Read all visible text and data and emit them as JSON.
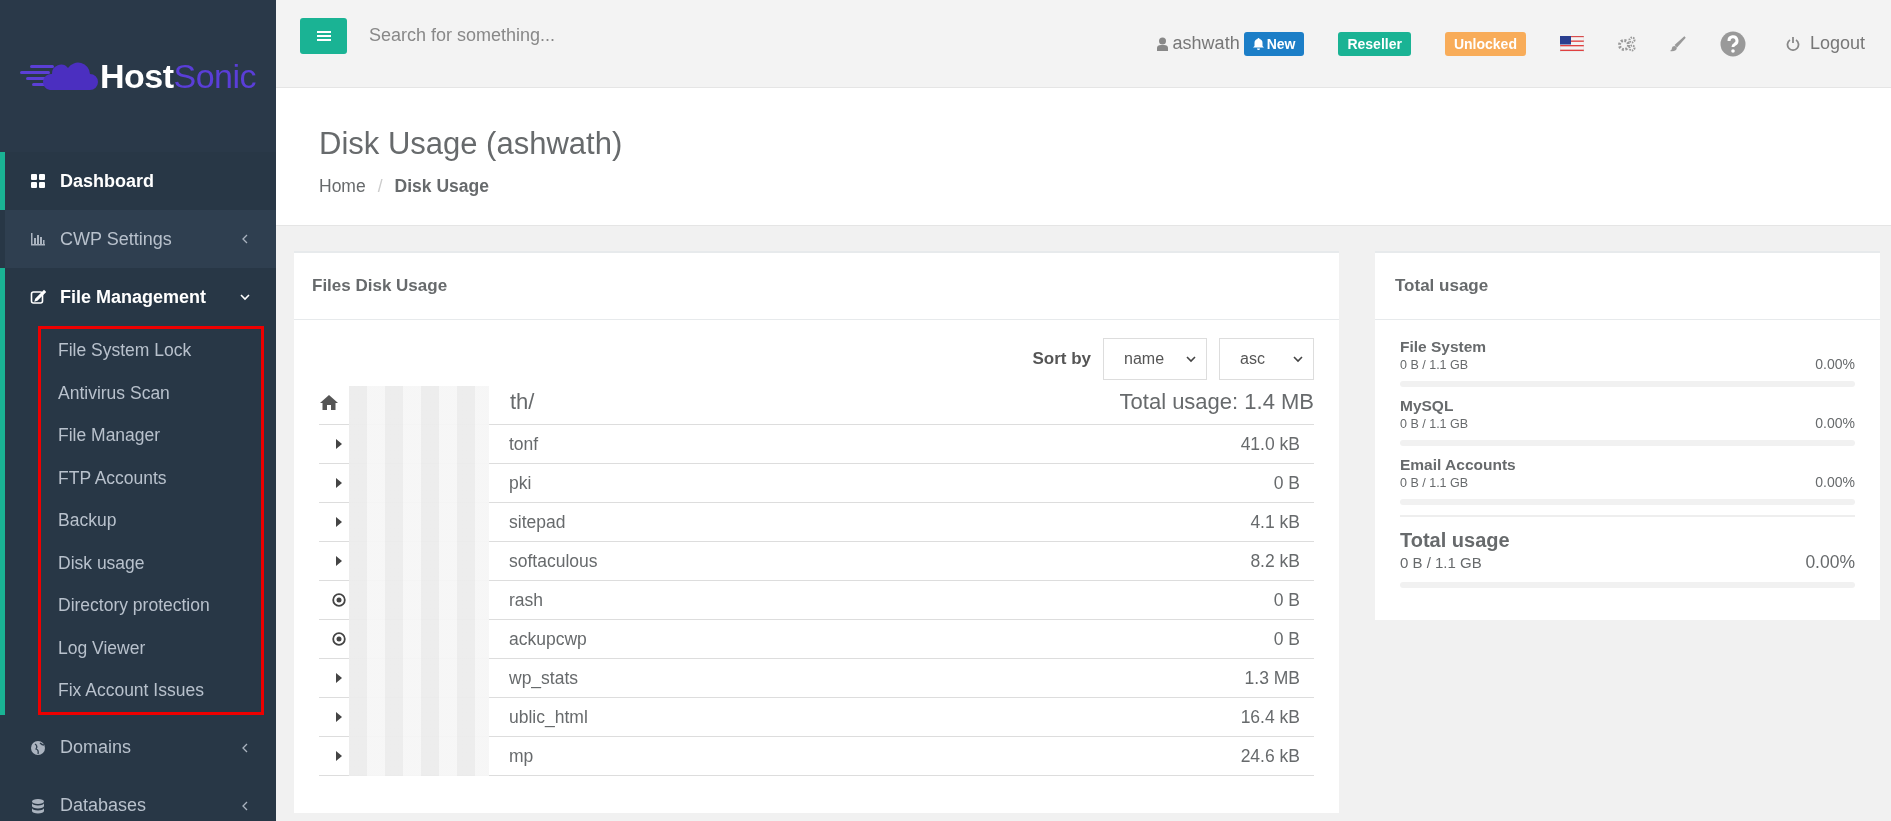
{
  "brand": {
    "part_1": "Host",
    "part_2": "Sonic"
  },
  "sidebar": {
    "items": [
      {
        "label": "Dashboard",
        "selected": true,
        "expanded": false,
        "has_children": false
      },
      {
        "label": "CWP Settings",
        "selected": false,
        "expanded": false,
        "has_children": true
      },
      {
        "label": "File Management",
        "selected": true,
        "expanded": true,
        "has_children": true,
        "highlighted": true,
        "children": [
          {
            "label": "File System Lock"
          },
          {
            "label": "Antivirus Scan"
          },
          {
            "label": "File Manager"
          },
          {
            "label": "FTP Accounts"
          },
          {
            "label": "Backup"
          },
          {
            "label": "Disk usage"
          },
          {
            "label": "Directory protection"
          },
          {
            "label": "Log Viewer"
          },
          {
            "label": "Fix Account Issues"
          }
        ]
      },
      {
        "label": "Domains",
        "selected": false,
        "expanded": false,
        "has_children": true
      },
      {
        "label": "Databases",
        "selected": false,
        "expanded": false,
        "has_children": true
      }
    ]
  },
  "header": {
    "search": {
      "placeholder": "Search for something..."
    },
    "user": "ashwath",
    "badges": [
      {
        "label": "New",
        "color": "#1c7ec7",
        "kind": "notification"
      },
      {
        "label": "Reseller",
        "color": "#1ab394",
        "kind": "tag"
      },
      {
        "label": "Unlocked",
        "color": "#f8ac59",
        "kind": "tag"
      }
    ],
    "logout": "Logout"
  },
  "page": {
    "title": "Disk Usage (ashwath)",
    "breadcrumb_separator": "/",
    "breadcrumb": [
      {
        "label": "Home",
        "current": false
      },
      {
        "label": "Disk Usage",
        "current": true
      }
    ]
  },
  "files_panel": {
    "title": "Files Disk Usage",
    "sort_label": "Sort by",
    "sort_field": "name",
    "sort_order": "asc",
    "path": "th/",
    "total": "Total usage: 1.4 MB",
    "rows": [
      {
        "kind": "folder",
        "name": "tonf",
        "size": "41.0 kB"
      },
      {
        "kind": "folder",
        "name": "pki",
        "size": "0 B"
      },
      {
        "kind": "folder",
        "name": "sitepad",
        "size": "4.1 kB"
      },
      {
        "kind": "folder",
        "name": "softaculous",
        "size": "8.2 kB"
      },
      {
        "kind": "link",
        "name": "rash",
        "size": "0 B"
      },
      {
        "kind": "link",
        "name": "ackupcwp",
        "size": "0 B"
      },
      {
        "kind": "folder",
        "name": "wp_stats",
        "size": "1.3 MB"
      },
      {
        "kind": "folder",
        "name": "ublic_html",
        "size": "16.4 kB"
      },
      {
        "kind": "folder",
        "name": "mp",
        "size": "24.6 kB"
      }
    ]
  },
  "usage_panel": {
    "title": "Total usage",
    "items": [
      {
        "label": "File System",
        "amount": "0 B / 1.1 GB",
        "percent": "0.00%",
        "level": 0
      },
      {
        "label": "MySQL",
        "amount": "0 B / 1.1 GB",
        "percent": "0.00%",
        "level": 0
      },
      {
        "label": "Email Accounts",
        "amount": "0 B / 1.1 GB",
        "percent": "0.00%",
        "level": 0
      }
    ],
    "total": {
      "label": "Total usage",
      "amount": "0 B / 1.1 GB",
      "percent": "0.00%",
      "level": 0
    }
  }
}
